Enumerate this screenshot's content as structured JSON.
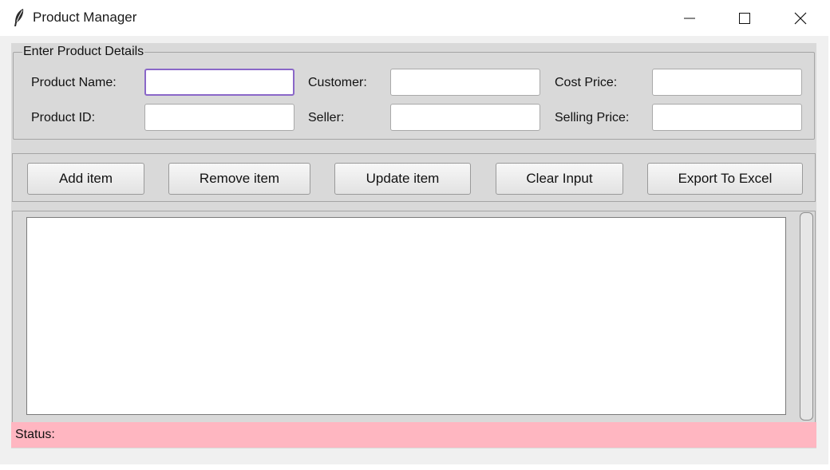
{
  "window": {
    "title": "Product Manager",
    "app_icon": "feather-icon",
    "controls": [
      "minimize-icon",
      "maximize-icon",
      "close-icon"
    ]
  },
  "form": {
    "group_title": "Enter Product Details",
    "fields": {
      "product_name": {
        "label": "Product Name:",
        "value": ""
      },
      "product_id": {
        "label": "Product ID:",
        "value": ""
      },
      "customer": {
        "label": "Customer:",
        "value": ""
      },
      "seller": {
        "label": "Seller:",
        "value": ""
      },
      "cost_price": {
        "label": "Cost Price:",
        "value": ""
      },
      "selling_price": {
        "label": "Selling Price:",
        "value": ""
      }
    }
  },
  "buttons": {
    "add": "Add item",
    "remove": "Remove item",
    "update": "Update item",
    "clear": "Clear Input",
    "export": "Export To Excel"
  },
  "listbox": {
    "items": []
  },
  "status": {
    "label": "Status:",
    "text": ""
  },
  "colors": {
    "panel_bg": "#d9d9d9",
    "status_bg": "#ffb6c1",
    "focus_border": "#8a67c8"
  }
}
